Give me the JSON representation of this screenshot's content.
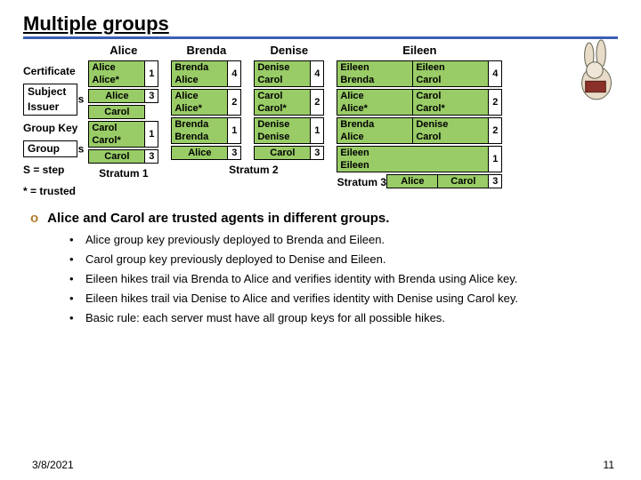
{
  "title": "Multiple groups",
  "legend": {
    "certificate": "Certificate",
    "subject": "Subject",
    "issuer": "Issuer",
    "s": "s",
    "groupkey": "Group Key",
    "group": "Group",
    "sstep": "S = step",
    "trusted": "* = trusted"
  },
  "people": {
    "alice": {
      "name": "Alice",
      "rows": [
        [
          "Alice",
          "Alice*",
          "1"
        ],
        [
          "spacer",
          "Alice",
          "3"
        ],
        [
          "spacer",
          "Carol",
          ""
        ],
        [
          "Carol",
          "Carol*",
          "1"
        ],
        [
          "spacer",
          "Carol",
          "3"
        ]
      ],
      "stratum": "Stratum 1"
    },
    "brenda": {
      "name": "Brenda",
      "rows": [
        [
          "Brenda",
          "Alice",
          "4"
        ],
        [
          "Alice",
          "Alice*",
          "2"
        ],
        [
          "Brenda",
          "Brenda",
          "1"
        ],
        [
          "spacer",
          "Alice",
          "3"
        ]
      ],
      "stratum": ""
    },
    "denise": {
      "name": "Denise",
      "rows": [
        [
          "Denise",
          "Carol",
          "4"
        ],
        [
          "Carol",
          "Carol*",
          "2"
        ],
        [
          "Denise",
          "Denise",
          "1"
        ],
        [
          "spacer",
          "Carol",
          "3"
        ]
      ],
      "stratum": "Stratum 2"
    },
    "eileen": {
      "name": "Eileen",
      "pairs": [
        [
          [
            "Eileen",
            "Brenda"
          ],
          [
            "Eileen",
            "Carol"
          ],
          "4"
        ],
        [
          [
            "Alice",
            "Alice*"
          ],
          [
            "Carol",
            "Carol*"
          ],
          "2"
        ],
        [
          [
            "Brenda",
            "Alice"
          ],
          [
            "Denise",
            "Carol"
          ],
          "2"
        ],
        [
          [
            "Eileen",
            "Eileen"
          ],
          null,
          "1"
        ]
      ],
      "last": [
        [
          "spacer",
          "Alice"
        ],
        [
          "spacer",
          "Carol"
        ],
        "3"
      ],
      "stratum": "Stratum 3"
    }
  },
  "main_bullet": "Alice and Carol are trusted agents in different groups.",
  "subs": [
    "Alice group key previously deployed to Brenda and Eileen.",
    "Carol group key previously deployed to Denise and Eileen.",
    "Eileen hikes trail via Brenda to Alice and verifies identity with Brenda using Alice key.",
    "Eileen hikes trail via Denise to Alice and verifies identity with Denise using Carol key.",
    "Basic rule: each server must have all group keys for all possible hikes."
  ],
  "date": "3/8/2021",
  "page": "11"
}
